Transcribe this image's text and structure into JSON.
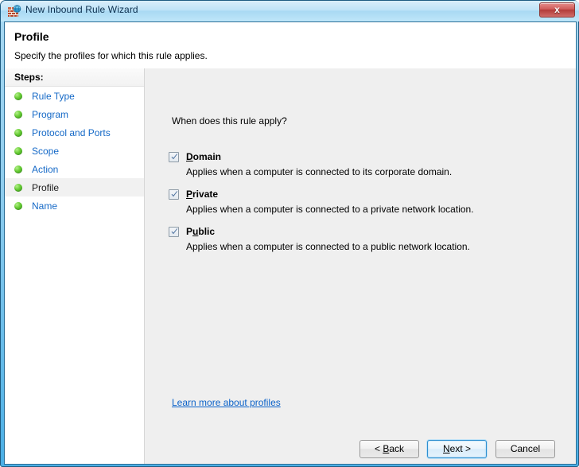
{
  "window": {
    "title": "New Inbound Rule Wizard",
    "title_icon": "firewall-icon",
    "close_label": "x",
    "frame_color": "#4aafe6"
  },
  "header": {
    "title": "Profile",
    "subtitle": "Specify the profiles for which this rule applies."
  },
  "sidebar": {
    "heading": "Steps:",
    "items": [
      {
        "label": "Rule Type",
        "current": false
      },
      {
        "label": "Program",
        "current": false
      },
      {
        "label": "Protocol and Ports",
        "current": false
      },
      {
        "label": "Scope",
        "current": false
      },
      {
        "label": "Action",
        "current": false
      },
      {
        "label": "Profile",
        "current": true
      },
      {
        "label": "Name",
        "current": false
      }
    ],
    "link_color": "#1569c7",
    "bullet_color": "#66cc33"
  },
  "content": {
    "question": "When does this rule apply?",
    "options": [
      {
        "label": "Domain",
        "accel_before": "",
        "accel": "D",
        "accel_after": "omain",
        "checked": true,
        "description": "Applies when a computer is connected to its corporate domain."
      },
      {
        "label": "Private",
        "accel_before": "",
        "accel": "P",
        "accel_after": "rivate",
        "checked": true,
        "description": "Applies when a computer is connected to a private network location."
      },
      {
        "label": "Public",
        "accel_before": "P",
        "accel": "u",
        "accel_after": "blic",
        "checked": true,
        "description": "Applies when a computer is connected to a public network location."
      }
    ],
    "learn_more_link": "Learn more about profiles",
    "link_color": "#0b62c9"
  },
  "buttons": {
    "back": {
      "prefix": "< ",
      "accel": "B",
      "suffix": "ack"
    },
    "next": {
      "prefix": "",
      "accel": "N",
      "suffix": "ext >",
      "default": true
    },
    "cancel": {
      "label": "Cancel"
    }
  }
}
